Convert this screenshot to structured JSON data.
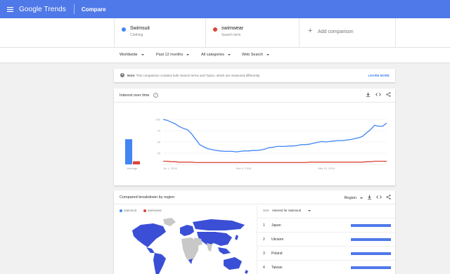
{
  "topbar": {
    "brand": "Google Trends",
    "page": "Compare",
    "color": "#4f79e8"
  },
  "terms": [
    {
      "name": "Swimsuit",
      "type": "Clothing",
      "color": "#4285f4"
    },
    {
      "name": "swimwear",
      "type": "Search term",
      "color": "#db4437"
    }
  ],
  "add_comparison": {
    "label": "Add comparison",
    "icon": "plus-icon"
  },
  "filters": [
    {
      "label": "Worldwide"
    },
    {
      "label": "Past 12 months"
    },
    {
      "label": "All categories"
    },
    {
      "label": "Web Search"
    }
  ],
  "note": {
    "label": "Note:",
    "text": "This comparison contains both Search terms and Topics, which are measured differently.",
    "link": "LEARN MORE"
  },
  "interest_card": {
    "title": "Interest over time",
    "help_icon": "?",
    "actions": [
      "download-icon",
      "embed-icon",
      "share-icon"
    ]
  },
  "chart_data": {
    "type": "line",
    "average_label": "Average",
    "average_values": [
      56,
      7
    ],
    "y_ticks": [
      "100",
      "75",
      "50",
      "25"
    ],
    "ylim": [
      0,
      100
    ],
    "x_tick_labels": [
      "Jul 1, 2018",
      "Nov 4, 2018",
      "Mar 10, 2019"
    ],
    "series": [
      {
        "name": "Swimsuit",
        "color": "#4285f4",
        "values": [
          100,
          98,
          94,
          90,
          84,
          80,
          77,
          68,
          56,
          44,
          39,
          35,
          33,
          31,
          30,
          29,
          29,
          29,
          28,
          29,
          30,
          30,
          31,
          31,
          32,
          34,
          37,
          38,
          40,
          40,
          40,
          41,
          41,
          42,
          44,
          44,
          45,
          47,
          49,
          51,
          50,
          51,
          52,
          53,
          53,
          54,
          55,
          57,
          59,
          62,
          70,
          77,
          87,
          85,
          85,
          92
        ]
      },
      {
        "name": "swimwear",
        "color": "#db4437",
        "values": [
          7,
          7,
          6,
          6,
          5,
          5,
          5,
          5,
          4,
          4,
          4,
          4,
          4,
          4,
          4,
          4,
          4,
          4,
          4,
          4,
          4,
          4,
          4,
          4,
          4,
          4,
          4,
          4,
          4,
          4,
          4,
          4,
          4,
          4,
          4,
          4,
          5,
          5,
          5,
          5,
          5,
          5,
          5,
          5,
          5,
          5,
          5,
          5,
          5,
          5,
          6,
          6,
          7,
          7,
          7,
          7
        ]
      }
    ]
  },
  "region_card": {
    "title": "Compared breakdown by region",
    "view_select": "Region",
    "actions": [
      "download-icon",
      "embed-icon",
      "share-icon"
    ],
    "legend": [
      "Swimsuit",
      "swimwear"
    ],
    "sort_label": "Sort",
    "sort_value": "Interest for Swimsuit",
    "rows": [
      {
        "rank": "1",
        "name": "Japan",
        "swimsuit": 1.0
      },
      {
        "rank": "2",
        "name": "Ukraine",
        "swimsuit": 1.0
      },
      {
        "rank": "3",
        "name": "Poland",
        "swimsuit": 1.0
      },
      {
        "rank": "4",
        "name": "Taiwan",
        "swimsuit": 1.0
      }
    ]
  }
}
